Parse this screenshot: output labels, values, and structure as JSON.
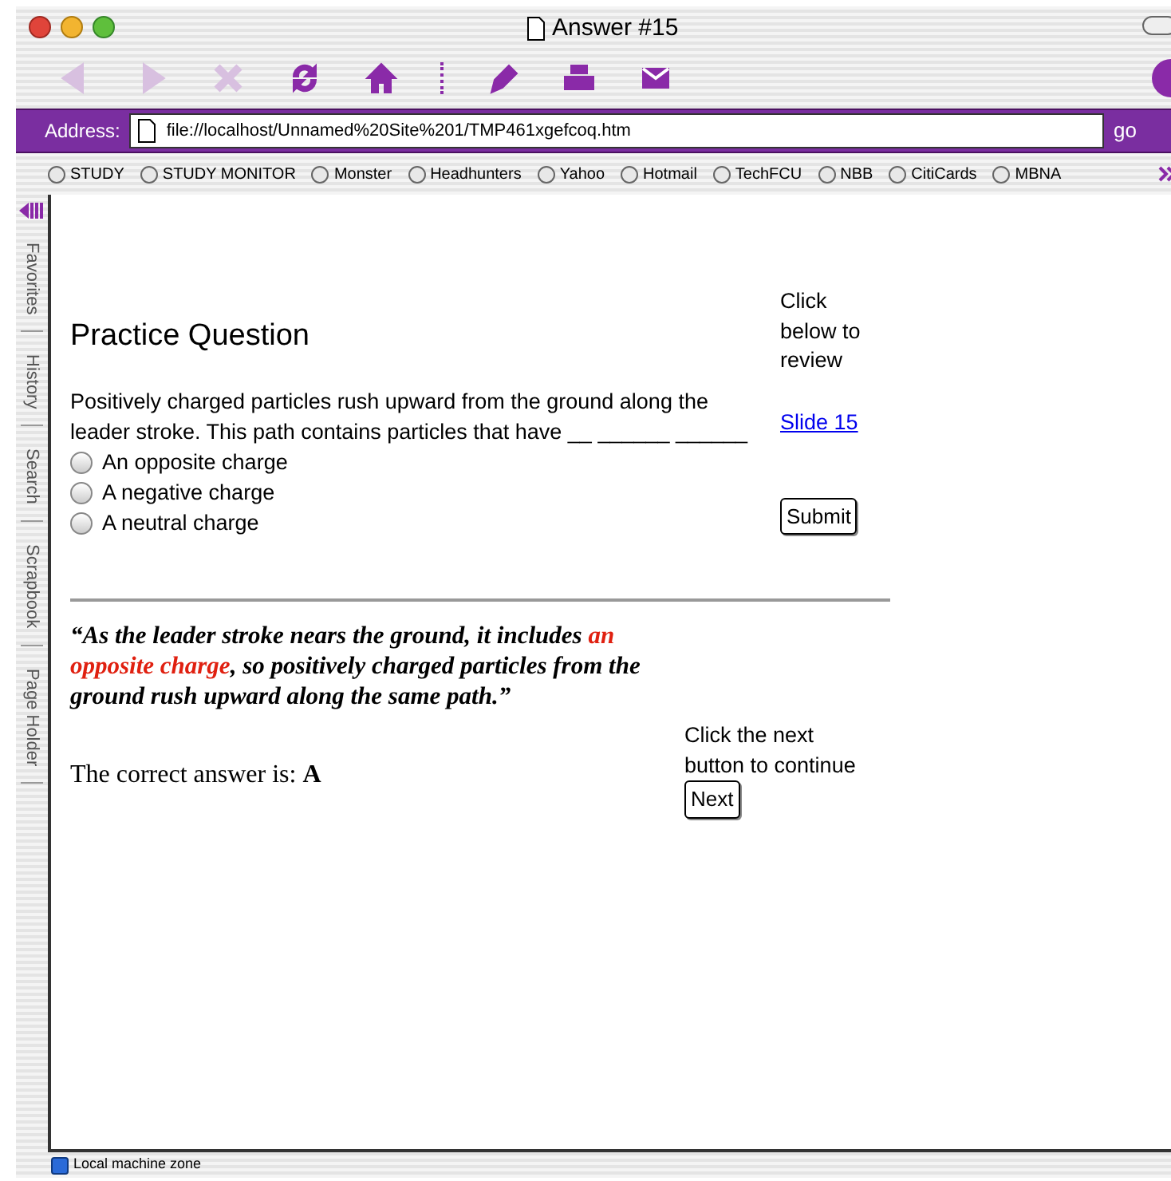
{
  "window": {
    "title": "Answer #15"
  },
  "toolbar": [
    {
      "kind": "back",
      "disabled": true
    },
    {
      "kind": "forward",
      "disabled": true
    },
    {
      "kind": "stop",
      "disabled": true
    },
    {
      "kind": "refresh",
      "disabled": false
    },
    {
      "kind": "home",
      "disabled": false
    },
    {
      "kind": "separator"
    },
    {
      "kind": "edit",
      "disabled": false
    },
    {
      "kind": "print",
      "disabled": false
    },
    {
      "kind": "mail",
      "disabled": false
    }
  ],
  "address": {
    "label": "Address:",
    "value": "file://localhost/Unnamed%20Site%201/TMP461xgefcoq.htm",
    "go": "go"
  },
  "favorites": [
    "STUDY",
    "STUDY MONITOR",
    "Monster",
    "Headhunters",
    "Yahoo",
    "Hotmail",
    "TechFCU",
    "NBB",
    "CitiCards",
    "MBNA"
  ],
  "side_tabs": [
    "Favorites",
    "History",
    "Search",
    "Scrapbook",
    "Page Holder"
  ],
  "page": {
    "heading": "Practice Question",
    "question": "Positively charged particles rush upward from the ground along the leader stroke. This path contains particles that have __ ______ ______",
    "options": [
      {
        "label": "An opposite charge",
        "selected": false
      },
      {
        "label": "A negative charge",
        "selected": false
      },
      {
        "label": "A neutral charge",
        "selected": false
      }
    ],
    "review_hint": "Click below to review",
    "review_link": "Slide 15",
    "submit": "Submit",
    "quote": [
      {
        "text": "“As the leader stroke nears the ground, it includes ",
        "highlight": false
      },
      {
        "text": "an opposite charge",
        "highlight": true
      },
      {
        "text": ", so positively charged particles from the ground rush upward along the same path.”",
        "highlight": false
      }
    ],
    "answer": "The correct answer is: **A**",
    "next_hint": "Click the next button to continue",
    "next": "Next"
  },
  "status_bar": {
    "text": "Local machine zone"
  }
}
